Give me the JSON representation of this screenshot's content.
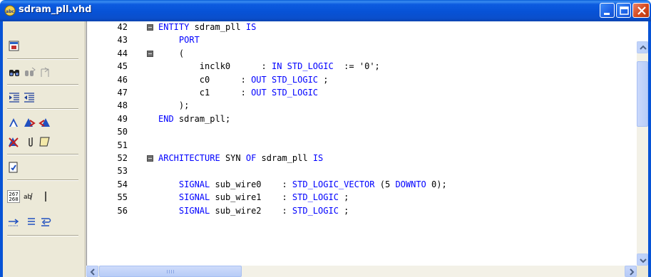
{
  "window": {
    "title": "sdram_pll.vhd",
    "app_icon": "vhdl-file-icon",
    "buttons": [
      "minimize",
      "maximize",
      "close"
    ]
  },
  "toolbar": {
    "icons": [
      "insert-template-icon",
      "find-icon",
      "find-next-icon",
      "go-to-line-icon",
      "indent-icon",
      "unindent-icon",
      "toggle-bookmark-icon",
      "next-bookmark-icon",
      "previous-bookmark-icon",
      "clear-bookmarks-icon",
      "attach-icon",
      "select-all-icon",
      "check-syntax-icon",
      "line-numbers-icon",
      "spell-check-icon",
      "cursor-icon",
      "tab-right-icon",
      "align-icon",
      "wrap-icon"
    ]
  },
  "editor": {
    "lines": [
      {
        "n": "42",
        "fold": true,
        "code": "ENTITY sdram_pll IS"
      },
      {
        "n": "43",
        "fold": false,
        "code": "    PORT"
      },
      {
        "n": "44",
        "fold": true,
        "code": "    ("
      },
      {
        "n": "45",
        "fold": false,
        "code": "        inclk0      : IN STD_LOGIC  := '0';"
      },
      {
        "n": "46",
        "fold": false,
        "code": "        c0      : OUT STD_LOGIC ;"
      },
      {
        "n": "47",
        "fold": false,
        "code": "        c1      : OUT STD_LOGIC"
      },
      {
        "n": "48",
        "fold": false,
        "code": "    );"
      },
      {
        "n": "49",
        "fold": false,
        "code": "END sdram_pll;"
      },
      {
        "n": "50",
        "fold": false,
        "code": ""
      },
      {
        "n": "51",
        "fold": false,
        "code": ""
      },
      {
        "n": "52",
        "fold": true,
        "code": "ARCHITECTURE SYN OF sdram_pll IS"
      },
      {
        "n": "53",
        "fold": false,
        "code": ""
      },
      {
        "n": "54",
        "fold": false,
        "code": "    SIGNAL sub_wire0    : STD_LOGIC_VECTOR (5 DOWNTO 0);"
      },
      {
        "n": "55",
        "fold": false,
        "code": "    SIGNAL sub_wire1    : STD_LOGIC ;"
      },
      {
        "n": "56",
        "fold": false,
        "code": "    SIGNAL sub_wire2    : STD_LOGIC ;"
      }
    ],
    "keywords": [
      "ENTITY",
      "IS",
      "PORT",
      "IN",
      "OUT",
      "STD_LOGIC",
      "STD_LOGIC_VECTOR",
      "DOWNTO",
      "END",
      "ARCHITECTURE",
      "OF",
      "SIGNAL"
    ],
    "colors": {
      "keyword": "#0000ff",
      "text": "#000000"
    }
  },
  "scrollbars": {
    "vertical": "scrollbar",
    "horizontal": "scrollbar"
  }
}
